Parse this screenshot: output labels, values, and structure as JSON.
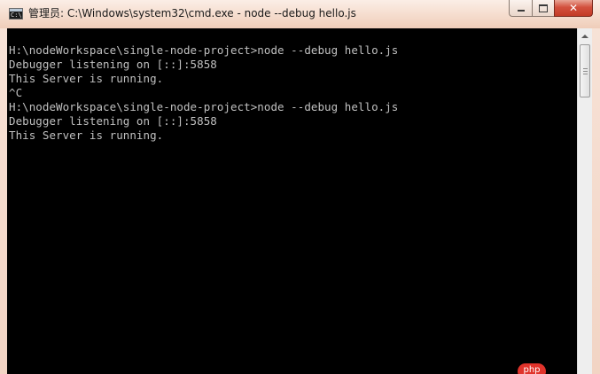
{
  "window": {
    "title": "管理员: C:\\Windows\\system32\\cmd.exe - node  --debug hello.js",
    "icon": "cmd-icon",
    "icon_glyph": "C:\\"
  },
  "controls": {
    "minimize_icon": "minimize-icon",
    "maximize_icon": "maximize-icon",
    "close_icon": "close-icon",
    "close_glyph": "✕"
  },
  "console": {
    "lines": [
      "",
      "H:\\nodeWorkspace\\single-node-project>node --debug hello.js",
      "Debugger listening on [::]:5858",
      "This Server is running.",
      "^C",
      "H:\\nodeWorkspace\\single-node-project>node --debug hello.js",
      "Debugger listening on [::]:5858",
      "This Server is running."
    ]
  },
  "watermark": {
    "text": "php"
  },
  "colors": {
    "console_background": "#000000",
    "console_text": "#c0c0c0",
    "titlebar": "#f5dccd",
    "close_button": "#c94a38"
  }
}
